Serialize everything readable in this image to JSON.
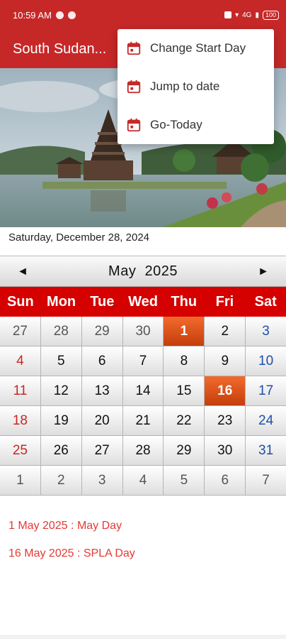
{
  "status_bar": {
    "time": "10:59 AM",
    "right_text": "4G",
    "battery": "100"
  },
  "app_bar": {
    "title": "South Sudan..."
  },
  "colors": {
    "primary": "#c62828",
    "header_row": "#d50000",
    "holiday_cell": "#e2561c",
    "sunday": "#c62828",
    "saturday": "#1f4fa8",
    "holiday_text": "#e53935"
  },
  "menu": {
    "items": [
      {
        "label": "Change Start Day",
        "icon": "calendar-icon"
      },
      {
        "label": "Jump to date",
        "icon": "calendar-icon"
      },
      {
        "label": "Go-Today",
        "icon": "calendar-icon"
      }
    ]
  },
  "current_date": "Saturday, December 28, 2024",
  "calendar": {
    "prev_label": "◄",
    "next_label": "►",
    "month": "May",
    "year": "2025",
    "weekdays": [
      "Sun",
      "Mon",
      "Tue",
      "Wed",
      "Thu",
      "Fri",
      "Sat"
    ],
    "weeks": [
      [
        "27",
        "28",
        "29",
        "30",
        "1",
        "2",
        "3"
      ],
      [
        "4",
        "5",
        "6",
        "7",
        "8",
        "9",
        "10"
      ],
      [
        "11",
        "12",
        "13",
        "14",
        "15",
        "16",
        "17"
      ],
      [
        "18",
        "19",
        "20",
        "21",
        "22",
        "23",
        "24"
      ],
      [
        "25",
        "26",
        "27",
        "28",
        "29",
        "30",
        "31"
      ],
      [
        "1",
        "2",
        "3",
        "4",
        "5",
        "6",
        "7"
      ]
    ]
  },
  "holidays": [
    "1 May 2025 : May Day",
    "16 May 2025 : SPLA Day"
  ]
}
